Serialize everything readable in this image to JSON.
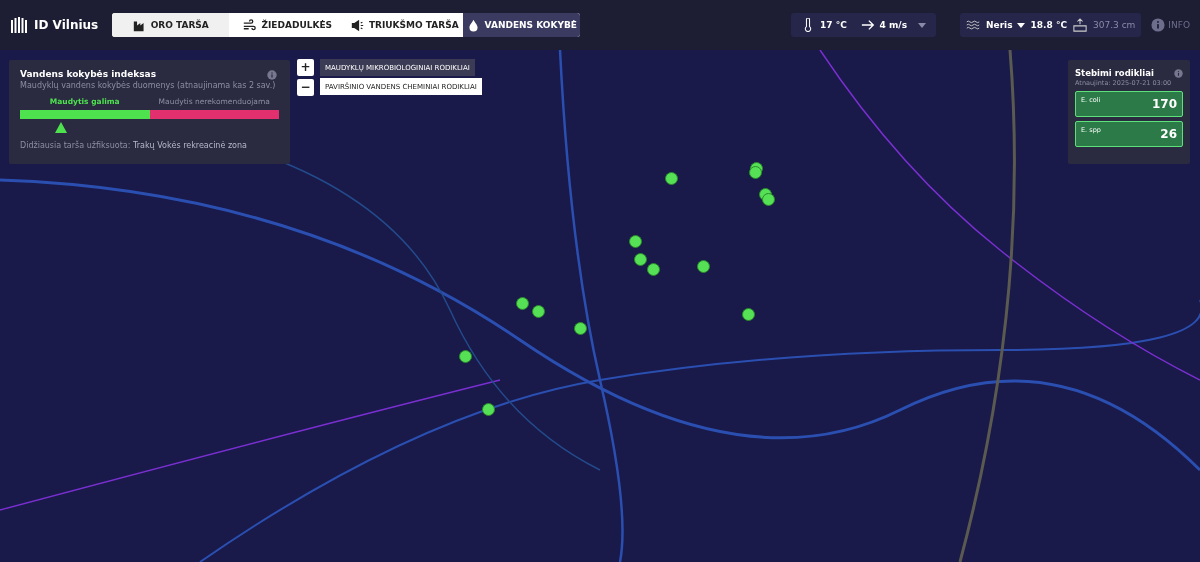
{
  "brand": {
    "name": "ID Vilnius"
  },
  "tabs": [
    {
      "label": "ORO TARŠA",
      "selected": false
    },
    {
      "label": "ŽIEDADULKĖS",
      "selected": false
    },
    {
      "label": "TRIUKŠMO TARŠA",
      "selected": false
    },
    {
      "label": "VANDENS KOKYBĖ",
      "selected": true
    }
  ],
  "weather": {
    "temperature": "17 °C",
    "wind": "4 m/s"
  },
  "river": {
    "name": "Neris",
    "water_temperature": "18.8 °C",
    "level_reading": "307.3 cm",
    "info": "INFO"
  },
  "index_panel": {
    "title": "Vandens kokybės indeksas",
    "subtitle": "Maudyklų vandens kokybės duomenys (atnaujinama kas 2 sav.)",
    "good_label": "Maudytis galima",
    "bad_label": "Maudytis nerekomenduojama",
    "level": 0.16,
    "worst_label": "Didžiausia tarša užfiksuota:",
    "worst_place": "Trakų Vokės rekreacinė zona"
  },
  "zoom_controls": [
    "+",
    "−"
  ],
  "layers": [
    {
      "label": "MAUDYKLŲ MIKROBIOLOGINIAI RODIKLIAI",
      "selected": true
    },
    {
      "label": "PAVIRŠINIO VANDENS CHEMINIAI RODIKLIAI",
      "selected": false
    }
  ],
  "indicators_panel": {
    "title": "Stebimi rodikliai",
    "updated": "Atnaujinta: 2025-07-21 03:00",
    "items": [
      {
        "name": "E. coli",
        "value": "170"
      },
      {
        "name": "E. spp",
        "value": "26"
      }
    ]
  }
}
